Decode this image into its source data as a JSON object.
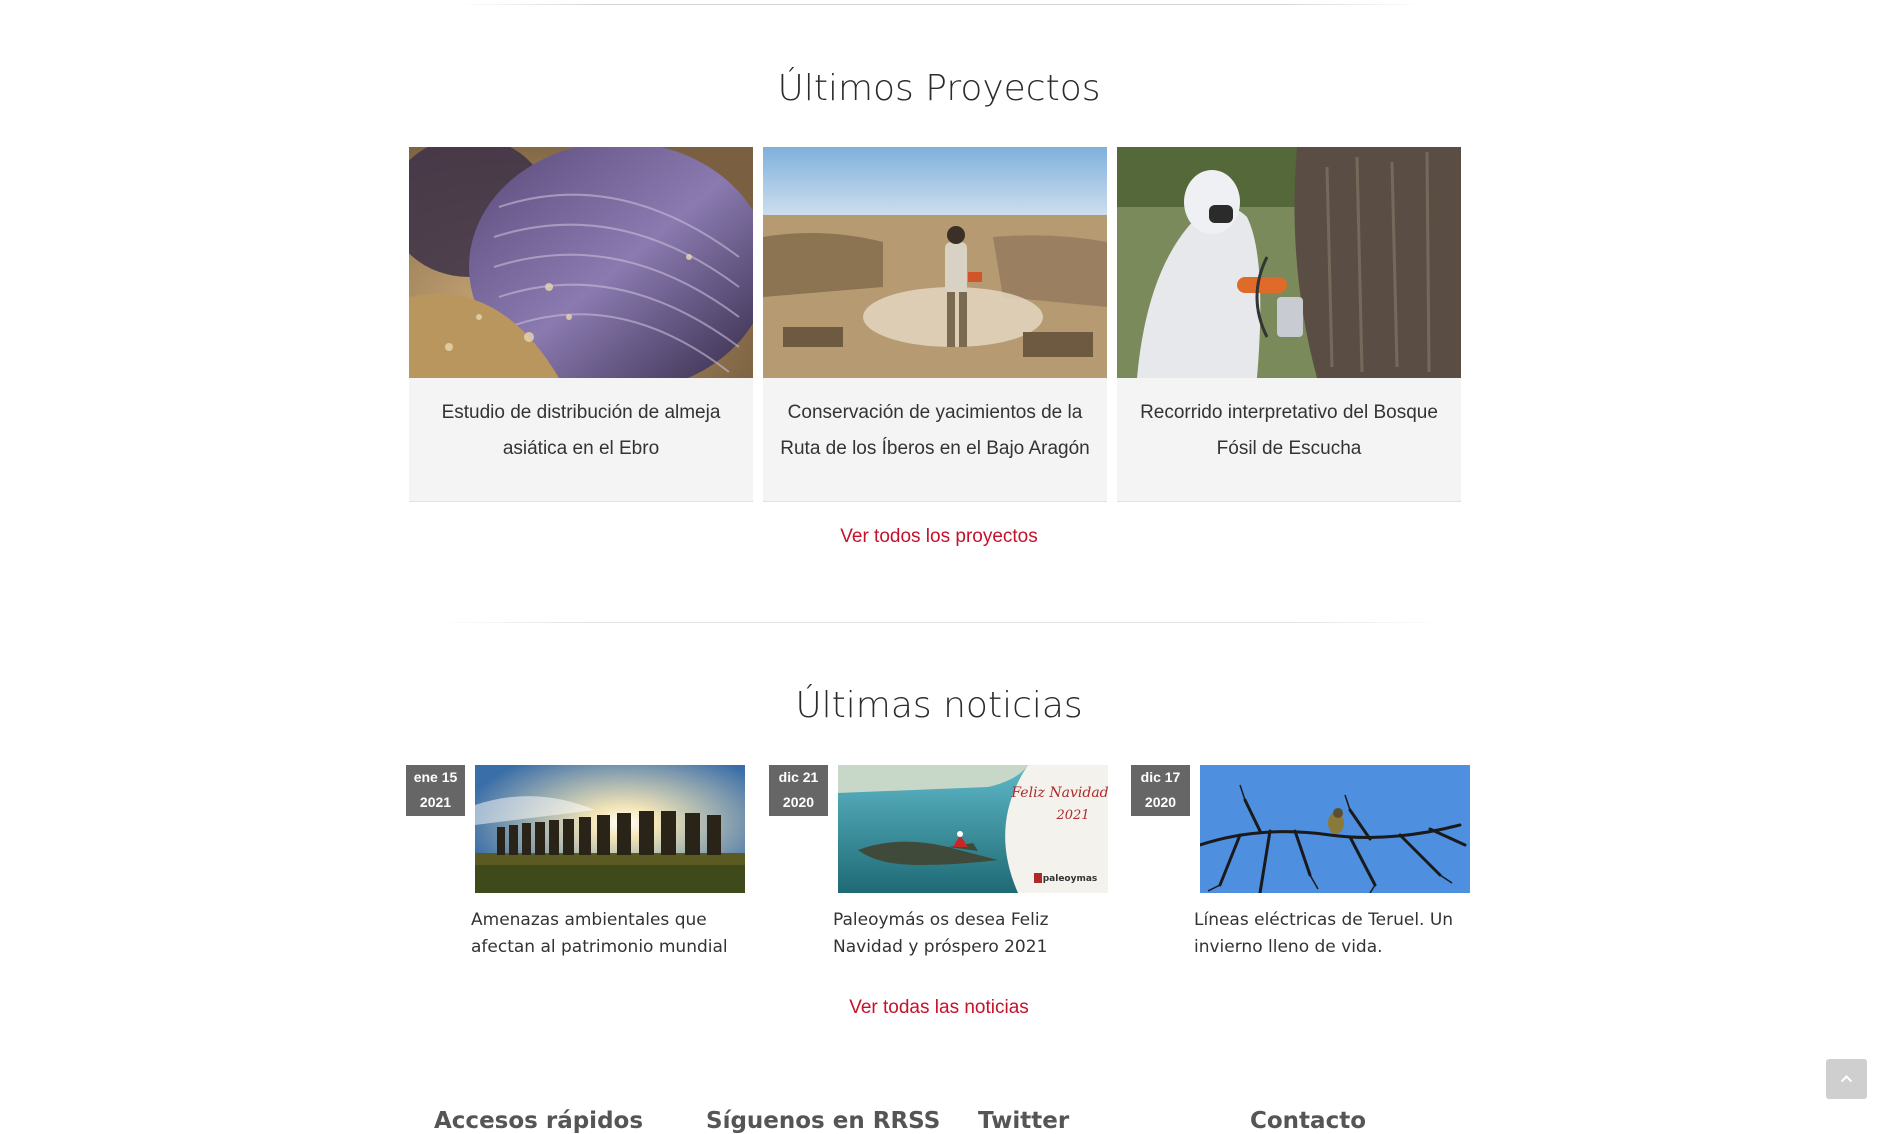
{
  "projects": {
    "title": "Últimos Proyectos",
    "items": [
      {
        "title": "Estudio de distribución de almeja asiática en el Ebro"
      },
      {
        "title": "Conservación de yacimientos de la Ruta de los Íberos en el Bajo Aragón"
      },
      {
        "title": "Recorrido interpretativo del Bosque Fósil de Escucha"
      }
    ],
    "more_label": "Ver todos los proyectos"
  },
  "news": {
    "title": "Últimas noticias",
    "items": [
      {
        "date_day": "ene 15",
        "date_year": "2021",
        "title": "Amenazas ambientales que afectan al patrimonio mundial"
      },
      {
        "date_day": "dic 21",
        "date_year": "2020",
        "title": "Paleoymás os desea Feliz Navidad y próspero 2021",
        "image_text": "Feliz Navidad",
        "image_year": "2021",
        "image_brand": "paleoymas"
      },
      {
        "date_day": "dic 17",
        "date_year": "2020",
        "title": "Líneas eléctricas de Teruel. Un invierno lleno de vida."
      }
    ],
    "more_label": "Ver todas las noticias"
  },
  "footer": {
    "headings": [
      "Accesos rápidos",
      "Síguenos en RRSS",
      "Twitter",
      "Contacto"
    ]
  },
  "colors": {
    "accent": "#c5112a",
    "date_badge": "#666666",
    "card_bg": "#f4f4f4"
  },
  "icons": {
    "scroll_top": "chevron-up-icon"
  }
}
